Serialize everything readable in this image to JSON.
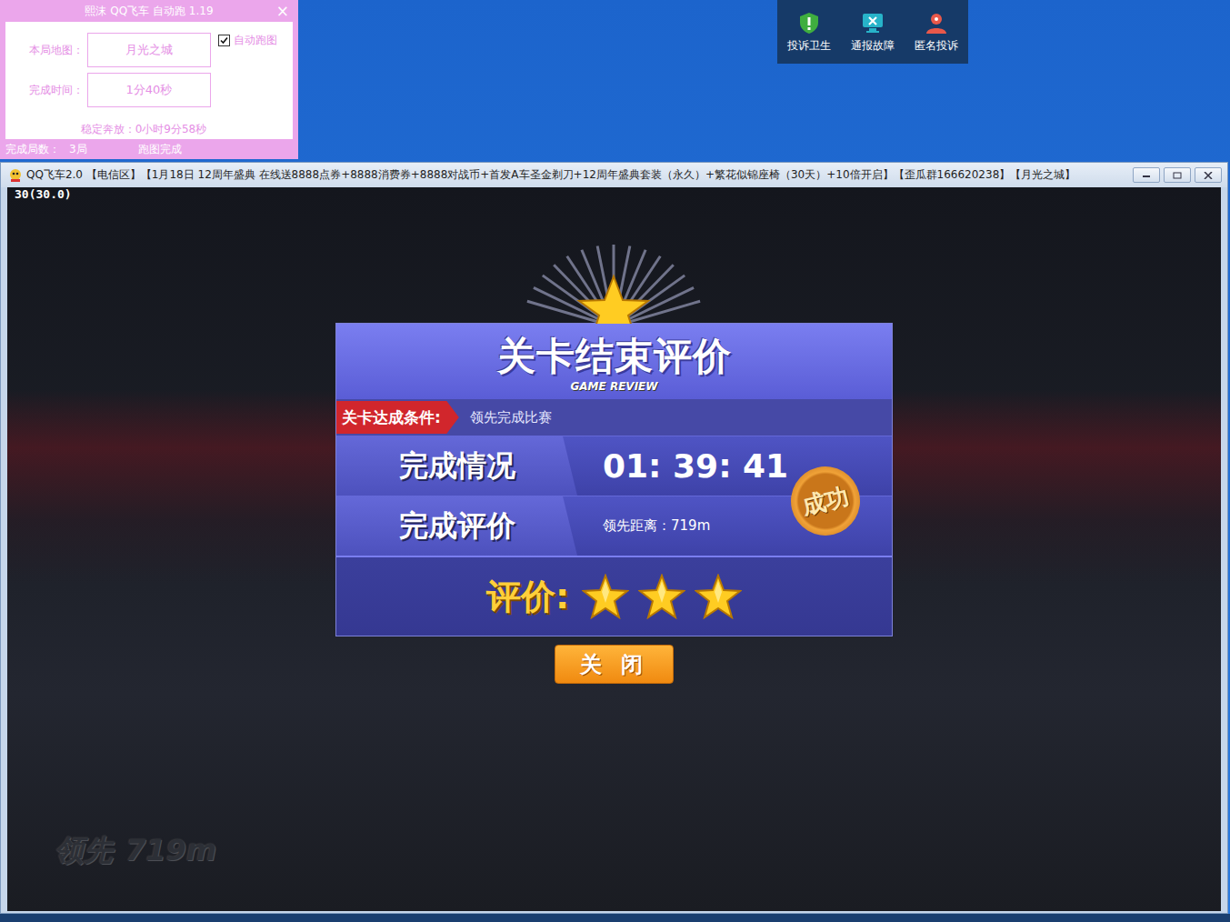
{
  "desktop": {
    "toolbar": [
      {
        "label": "投诉卫生",
        "color": "#3fae3f"
      },
      {
        "label": "通报故障",
        "color": "#27b3c9"
      },
      {
        "label": "匿名投诉",
        "color": "#e8584a"
      }
    ]
  },
  "tool_window": {
    "title": "熙沫 QQ飞车 自动跑 1.19",
    "close": "×",
    "fields": [
      {
        "label": "本局地图：",
        "value": "月光之城"
      },
      {
        "label": "完成时间：",
        "value": "1分40秒"
      }
    ],
    "checkbox": {
      "label": "自动跑图",
      "checked": true
    },
    "uptime": "稳定奔放：0小时9分58秒",
    "status": {
      "rounds_label": "完成局数：",
      "rounds": "3局",
      "message": "跑图完成"
    }
  },
  "game_window": {
    "title": "QQ飞车2.0 【电信区】【1月18日 12周年盛典 在线送8888点券+8888消费券+8888对战币+首发A车圣金剃刀+12周年盛典套装（永久）+繁花似锦座椅（30天）+10倍开启】【歪瓜群166620238】【月光之城】",
    "fps": "30(30.0)",
    "hud": {
      "label": "领先",
      "distance": "719m"
    },
    "review": {
      "title": "关卡结束评价",
      "subtitle": "GAME REVIEW",
      "condition_label": "关卡达成条件:",
      "condition": "领先完成比赛",
      "rows": [
        {
          "label": "完成情况",
          "value": "01: 39: 41",
          "kind": "time"
        },
        {
          "label": "完成评价",
          "value": "领先距离：719m",
          "kind": "note"
        }
      ],
      "stamp": "成功",
      "rating_label": "评价:",
      "stars": 3,
      "close_button": "关 闭"
    }
  }
}
